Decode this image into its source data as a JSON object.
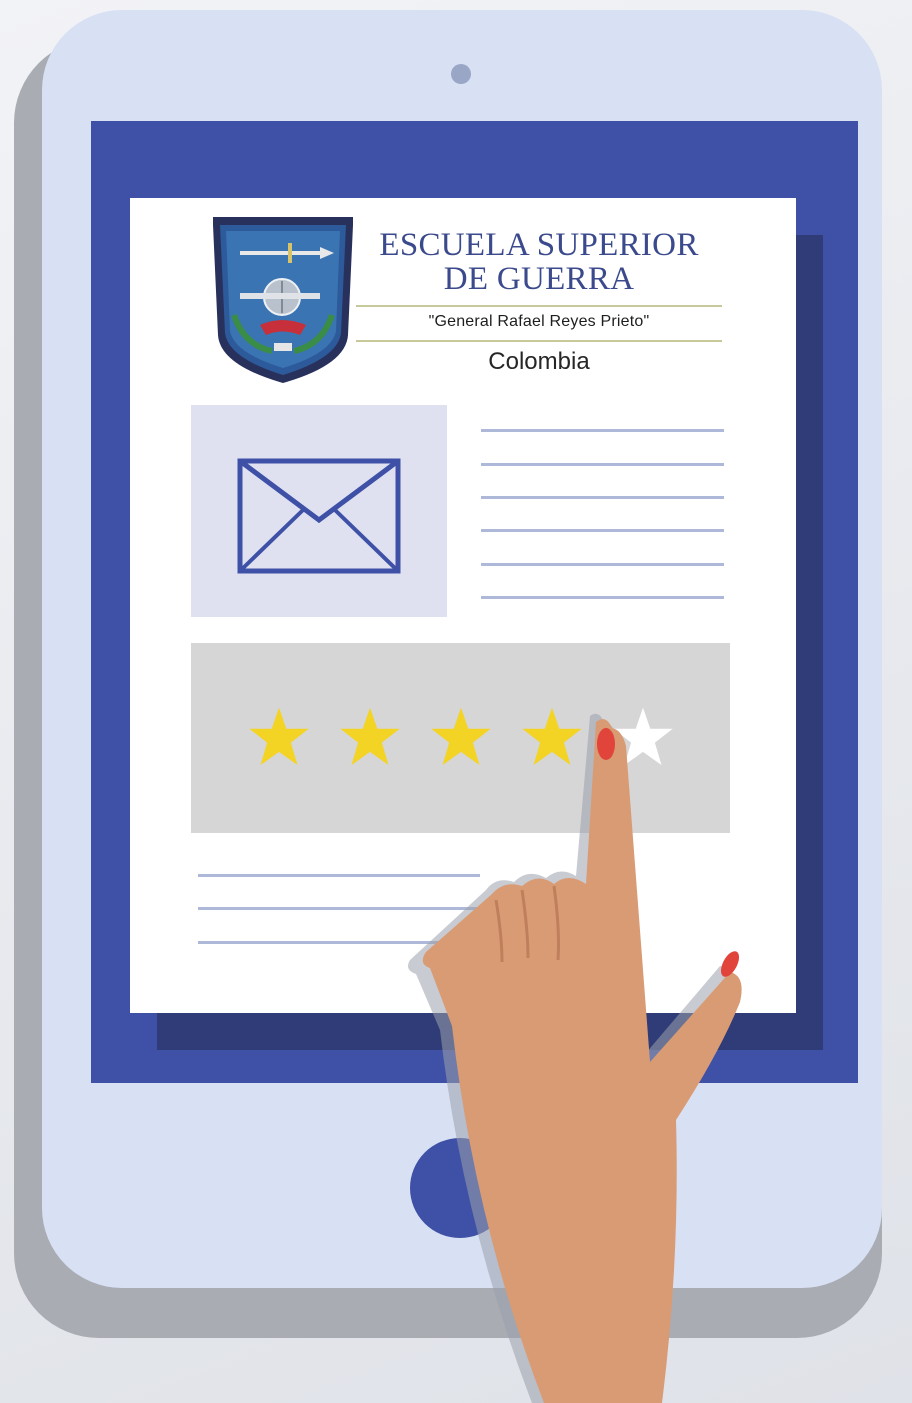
{
  "header": {
    "school_name_line1": "ESCUELA SUPERIOR",
    "school_name_line2": "DE GUERRA",
    "motto": "\"General Rafael Reyes Prieto\"",
    "country": "Colombia"
  },
  "icons": {
    "crest": "school-crest-icon",
    "email": "envelope-icon",
    "rating": "star-icon",
    "pointer": "pointing-hand-icon"
  },
  "rating": {
    "value": 4,
    "max": 5
  },
  "colors": {
    "tablet_frame": "#d8e0f3",
    "screen": "#3f51a6",
    "title_text": "#3b4a8c",
    "star_filled": "#f3d324",
    "star_empty": "#ffffff",
    "nail": "#e0443a"
  }
}
